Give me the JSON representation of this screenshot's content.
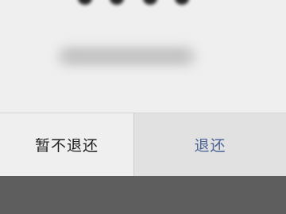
{
  "dialog": {
    "buttons": {
      "cancel_label": "暂不退还",
      "confirm_label": "退还"
    },
    "message_obscured": true
  },
  "colors": {
    "dialog_background": "#efefef",
    "pressed_button_background": "#e1e1e1",
    "confirm_text": "#4c6393",
    "overlay": "#5e5e5e"
  }
}
